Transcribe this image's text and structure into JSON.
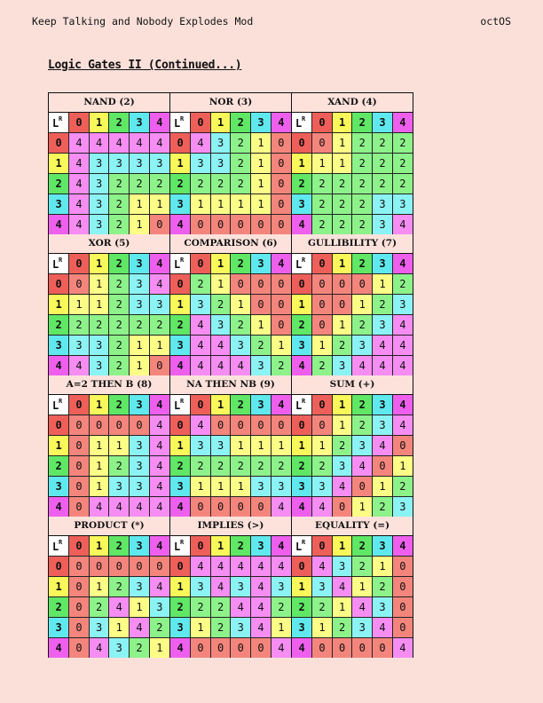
{
  "header": {
    "left": "Keep Talking and Nobody Explodes Mod",
    "right": "octOS"
  },
  "title": "Logic Gates II (Continued...)",
  "corner": {
    "l": "L",
    "r": "R"
  },
  "colors": {
    "0": "#f4857c",
    "1": "#fcfd86",
    "2": "#8df28a",
    "3": "#8cf3f4",
    "4": "#f58df3"
  },
  "headers": [
    "0",
    "1",
    "2",
    "3",
    "4"
  ],
  "tables": [
    {
      "name": "NAND (2)",
      "rows": [
        [
          4,
          4,
          4,
          4,
          4
        ],
        [
          4,
          3,
          3,
          3,
          3
        ],
        [
          4,
          3,
          2,
          2,
          2
        ],
        [
          4,
          3,
          2,
          1,
          1
        ],
        [
          4,
          3,
          2,
          1,
          0
        ]
      ]
    },
    {
      "name": "NOR (3)",
      "rows": [
        [
          4,
          3,
          2,
          1,
          0
        ],
        [
          3,
          3,
          2,
          1,
          0
        ],
        [
          2,
          2,
          2,
          1,
          0
        ],
        [
          1,
          1,
          1,
          1,
          0
        ],
        [
          0,
          0,
          0,
          0,
          0
        ]
      ]
    },
    {
      "name": "XAND (4)",
      "rows": [
        [
          0,
          1,
          2,
          2,
          2
        ],
        [
          1,
          1,
          2,
          2,
          2
        ],
        [
          2,
          2,
          2,
          2,
          2
        ],
        [
          2,
          2,
          2,
          3,
          3
        ],
        [
          2,
          2,
          2,
          3,
          4
        ]
      ]
    },
    {
      "name": "XOR (5)",
      "rows": [
        [
          0,
          1,
          2,
          3,
          4
        ],
        [
          1,
          1,
          2,
          3,
          3
        ],
        [
          2,
          2,
          2,
          2,
          2
        ],
        [
          3,
          3,
          2,
          1,
          1
        ],
        [
          4,
          3,
          2,
          1,
          0
        ]
      ]
    },
    {
      "name": "COMPARISON (6)",
      "rows": [
        [
          2,
          1,
          0,
          0,
          0
        ],
        [
          3,
          2,
          1,
          0,
          0
        ],
        [
          4,
          3,
          2,
          1,
          0
        ],
        [
          4,
          4,
          3,
          2,
          1
        ],
        [
          4,
          4,
          4,
          3,
          2
        ]
      ]
    },
    {
      "name": "GULLIBILITY (7)",
      "rows": [
        [
          0,
          0,
          0,
          1,
          2
        ],
        [
          0,
          0,
          1,
          2,
          3
        ],
        [
          0,
          1,
          2,
          3,
          4
        ],
        [
          1,
          2,
          3,
          4,
          4
        ],
        [
          2,
          3,
          4,
          4,
          4
        ]
      ]
    },
    {
      "name": "A=2 THEN B (8)",
      "rows": [
        [
          0,
          0,
          0,
          0,
          4
        ],
        [
          0,
          1,
          1,
          3,
          4
        ],
        [
          0,
          1,
          2,
          3,
          4
        ],
        [
          0,
          1,
          3,
          3,
          4
        ],
        [
          0,
          4,
          4,
          4,
          4
        ]
      ]
    },
    {
      "name": "NA THEN NB (9)",
      "rows": [
        [
          4,
          0,
          0,
          0,
          0
        ],
        [
          3,
          3,
          1,
          1,
          1
        ],
        [
          2,
          2,
          2,
          2,
          2
        ],
        [
          1,
          1,
          1,
          3,
          3
        ],
        [
          0,
          0,
          0,
          0,
          4
        ]
      ]
    },
    {
      "name": "SUM (+)",
      "rows": [
        [
          0,
          1,
          2,
          3,
          4
        ],
        [
          1,
          2,
          3,
          4,
          0
        ],
        [
          2,
          3,
          4,
          0,
          1
        ],
        [
          3,
          4,
          0,
          1,
          2
        ],
        [
          4,
          0,
          1,
          2,
          3
        ]
      ]
    },
    {
      "name": "PRODUCT (*)",
      "rows": [
        [
          0,
          0,
          0,
          0,
          0
        ],
        [
          0,
          1,
          2,
          3,
          4
        ],
        [
          0,
          2,
          4,
          1,
          3
        ],
        [
          0,
          3,
          1,
          4,
          2
        ],
        [
          0,
          4,
          3,
          2,
          1
        ]
      ]
    },
    {
      "name": "IMPLIES (>)",
      "rows": [
        [
          4,
          4,
          4,
          4,
          4
        ],
        [
          3,
          4,
          3,
          4,
          3
        ],
        [
          2,
          2,
          4,
          4,
          2
        ],
        [
          1,
          2,
          3,
          4,
          1
        ],
        [
          0,
          0,
          0,
          0,
          4
        ]
      ]
    },
    {
      "name": "EQUALITY (=)",
      "rows": [
        [
          4,
          3,
          2,
          1,
          0
        ],
        [
          3,
          4,
          1,
          2,
          0
        ],
        [
          2,
          1,
          4,
          3,
          0
        ],
        [
          1,
          2,
          3,
          4,
          0
        ],
        [
          0,
          0,
          0,
          0,
          4
        ]
      ]
    }
  ]
}
